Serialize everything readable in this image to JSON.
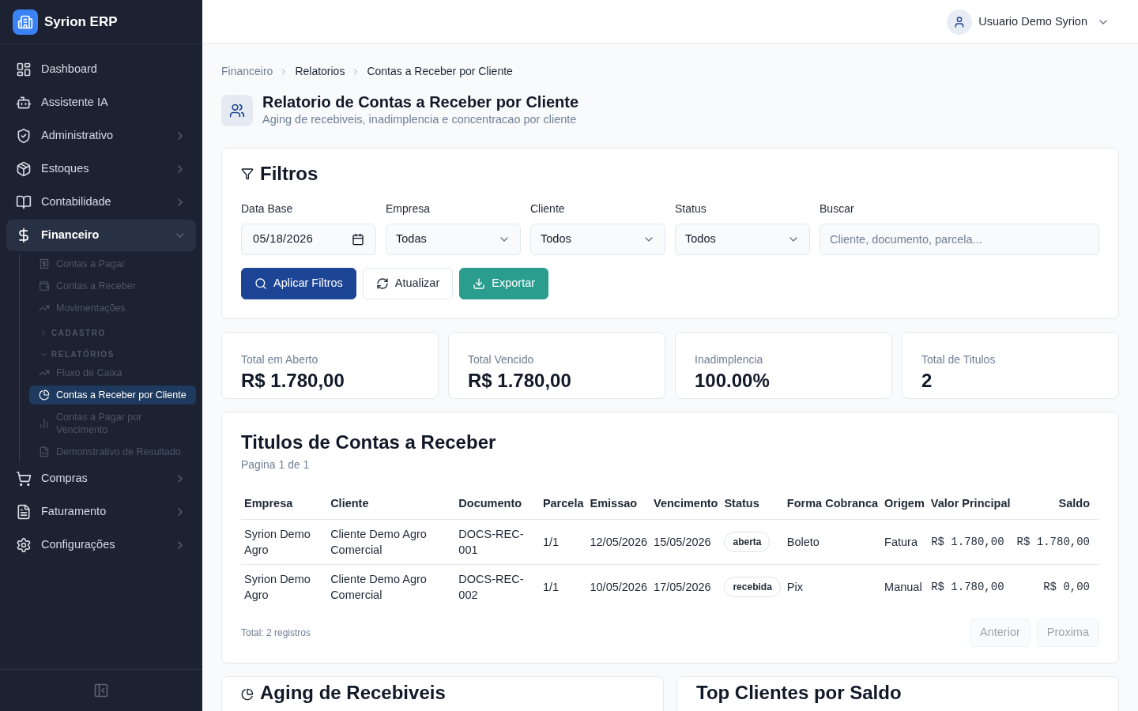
{
  "app": {
    "name": "Syrion ERP"
  },
  "sidebar": {
    "items": [
      {
        "label": "Dashboard",
        "kind": "link",
        "expanded": false
      },
      {
        "label": "Assistente IA",
        "kind": "link",
        "expanded": false
      },
      {
        "label": "Administrativo",
        "kind": "group",
        "expanded": false
      },
      {
        "label": "Estoques",
        "kind": "group",
        "expanded": false
      },
      {
        "label": "Contabilidade",
        "kind": "group",
        "expanded": false
      },
      {
        "label": "Financeiro",
        "kind": "group",
        "expanded": true,
        "children": [
          {
            "label": "Contas a Pagar",
            "kind": "link",
            "selected": false
          },
          {
            "label": "Contas a Receber",
            "kind": "link",
            "selected": false
          },
          {
            "label": "Movimentações",
            "kind": "link",
            "selected": false
          },
          {
            "label": "CADASTRO",
            "kind": "section",
            "expanded": false
          },
          {
            "label": "RELATÓRIOS",
            "kind": "section",
            "expanded": true,
            "children": [
              {
                "label": "Fluxo de Caixa",
                "kind": "link",
                "selected": false
              },
              {
                "label": "Contas a Receber por Cliente",
                "kind": "link",
                "selected": true
              },
              {
                "label": "Contas a Pagar por Vencimento",
                "kind": "link",
                "selected": false
              },
              {
                "label": "Demonstrativo de Resultado",
                "kind": "link",
                "selected": false
              }
            ]
          }
        ]
      },
      {
        "label": "Compras",
        "kind": "group",
        "expanded": false
      },
      {
        "label": "Faturamento",
        "kind": "group",
        "expanded": false
      },
      {
        "label": "Configurações",
        "kind": "group",
        "expanded": false
      }
    ]
  },
  "header": {
    "user": "Usuario Demo Syrion"
  },
  "breadcrumb": [
    "Financeiro",
    "Relatorios",
    "Contas a Receber por Cliente"
  ],
  "page": {
    "title": "Relatorio de Contas a Receber por Cliente",
    "subtitle": "Aging de recebiveis, inadimplencia e concentracao por cliente"
  },
  "filters": {
    "title": "Filtros",
    "fields": [
      {
        "label": "Data Base",
        "kind": "date",
        "value": "05/18/2026"
      },
      {
        "label": "Empresa",
        "kind": "select",
        "value": "Todas"
      },
      {
        "label": "Cliente",
        "kind": "select",
        "value": "Todos"
      },
      {
        "label": "Status",
        "kind": "select",
        "value": "Todos"
      },
      {
        "label": "Buscar",
        "kind": "search",
        "placeholder": "Cliente, documento, parcela..."
      }
    ],
    "buttons": [
      {
        "label": "Aplicar Filtros",
        "kind": "primary"
      },
      {
        "label": "Atualizar",
        "kind": "outline"
      },
      {
        "label": "Exportar",
        "kind": "success"
      }
    ]
  },
  "stats": [
    {
      "label": "Total em Aberto",
      "value": "R$ 1.780,00"
    },
    {
      "label": "Total Vencido",
      "value": "R$ 1.780,00"
    },
    {
      "label": "Inadimplencia",
      "value": "100.00%"
    },
    {
      "label": "Total de Titulos",
      "value": "2"
    }
  ],
  "table": {
    "title": "Titulos de Contas a Receber",
    "subtitle": "Pagina 1 de 1",
    "columns": [
      {
        "label": "Empresa",
        "kind": "text"
      },
      {
        "label": "Cliente",
        "kind": "text"
      },
      {
        "label": "Documento",
        "kind": "text"
      },
      {
        "label": "Parcela",
        "kind": "text"
      },
      {
        "label": "Emissao",
        "kind": "text"
      },
      {
        "label": "Vencimento",
        "kind": "text"
      },
      {
        "label": "Status",
        "kind": "badge"
      },
      {
        "label": "Forma Cobranca",
        "kind": "text"
      },
      {
        "label": "Origem",
        "kind": "text"
      },
      {
        "label": "Valor Principal",
        "kind": "money"
      },
      {
        "label": "Saldo",
        "kind": "money"
      }
    ],
    "rows": [
      [
        "Syrion Demo Agro",
        "Cliente Demo Agro Comercial",
        "DOCS-REC-001",
        "1/1",
        "12/05/2026",
        "15/05/2026",
        "aberta",
        "Boleto",
        "Fatura",
        "R$ 1.780,00",
        "R$ 1.780,00"
      ],
      [
        "Syrion Demo Agro",
        "Cliente Demo Agro Comercial",
        "DOCS-REC-002",
        "1/1",
        "10/05/2026",
        "17/05/2026",
        "recebida",
        "Pix",
        "Manual",
        "R$ 1.780,00",
        "R$ 0,00"
      ]
    ],
    "total": "Total: 2 registros",
    "pager": [
      {
        "label": "Anterior",
        "disabled": true
      },
      {
        "label": "Proxima",
        "disabled": true
      }
    ]
  },
  "bottom_cards": [
    {
      "title": "Aging de Recebiveis",
      "kind": "pie"
    },
    {
      "title": "Top Clientes por Saldo",
      "kind": "plain"
    }
  ]
}
